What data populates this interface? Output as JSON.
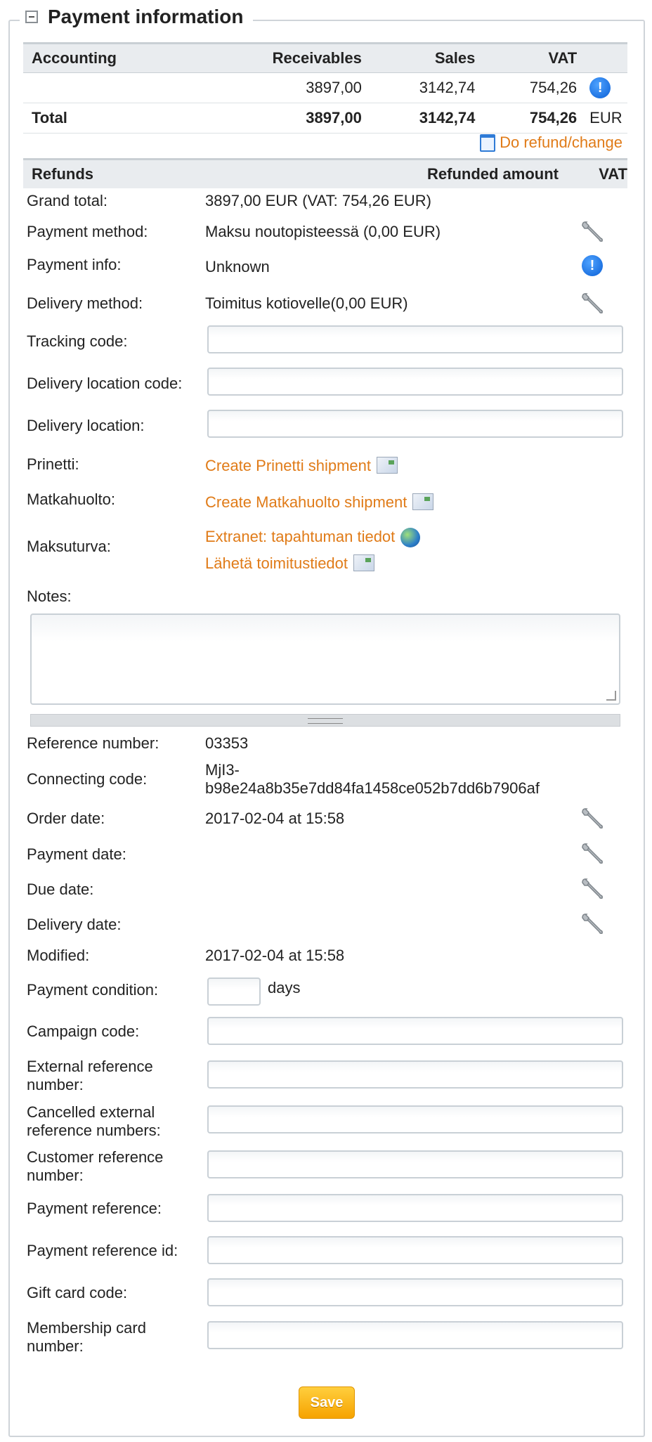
{
  "section": {
    "title": "Payment information"
  },
  "accounting": {
    "headers": [
      "Accounting",
      "Receivables",
      "Sales",
      "VAT"
    ],
    "row": {
      "receivables": "3897,00",
      "sales": "3142,74",
      "vat": "754,26"
    },
    "total": {
      "label": "Total",
      "receivables": "3897,00",
      "sales": "3142,74",
      "vat": "754,26",
      "currency": "EUR"
    }
  },
  "refund_link": "Do refund/change",
  "refunds": {
    "headers": [
      "Refunds",
      "Refunded amount",
      "VAT"
    ]
  },
  "fields": {
    "grand_total": {
      "label": "Grand total:",
      "value": "3897,00 EUR (VAT: 754,26 EUR)"
    },
    "payment_method": {
      "label": "Payment method:",
      "value": "Maksu noutopisteessä (0,00 EUR)"
    },
    "payment_info": {
      "label": "Payment info:",
      "value": "Unknown"
    },
    "delivery_method": {
      "label": "Delivery method:",
      "value": "Toimitus kotiovelle(0,00 EUR)"
    },
    "tracking_code": {
      "label": "Tracking code:",
      "value": ""
    },
    "delivery_location_code": {
      "label": "Delivery location code:",
      "value": ""
    },
    "delivery_location": {
      "label": "Delivery location:",
      "value": ""
    },
    "prinetti": {
      "label": "Prinetti:",
      "link": "Create Prinetti shipment"
    },
    "matkahuolto": {
      "label": "Matkahuolto:",
      "link": "Create Matkahuolto shipment"
    },
    "maksuturva": {
      "label": "Maksuturva:",
      "link1": "Extranet: tapahtuman tiedot",
      "link2": "Lähetä toimitustiedot"
    },
    "notes": {
      "label": "Notes:",
      "value": ""
    },
    "reference_number": {
      "label": "Reference number:",
      "value": "03353"
    },
    "connecting_code": {
      "label": "Connecting code:",
      "value_line1": "MjI3-",
      "value_line2": "b98e24a8b35e7dd84fa1458ce052b7dd6b7906af"
    },
    "order_date": {
      "label": "Order date:",
      "value": "2017-02-04 at 15:58"
    },
    "payment_date": {
      "label": "Payment date:",
      "value": ""
    },
    "due_date": {
      "label": "Due date:",
      "value": ""
    },
    "delivery_date": {
      "label": "Delivery date:",
      "value": ""
    },
    "modified": {
      "label": "Modified:",
      "value": "2017-02-04 at 15:58"
    },
    "payment_condition": {
      "label": "Payment condition:",
      "value": "",
      "unit": "days"
    },
    "campaign_code": {
      "label": "Campaign code:",
      "value": ""
    },
    "external_reference_number": {
      "label_line1": "External reference",
      "label_line2": "number:",
      "value": ""
    },
    "cancelled_external_reference_numbers": {
      "label_line1": "Cancelled external",
      "label_line2": "reference numbers:",
      "value": ""
    },
    "customer_reference_number": {
      "label_line1": "Customer reference",
      "label_line2": "number:",
      "value": ""
    },
    "payment_reference": {
      "label": "Payment reference:",
      "value": ""
    },
    "payment_reference_id": {
      "label": "Payment reference id:",
      "value": ""
    },
    "gift_card_code": {
      "label": "Gift card code:",
      "value": ""
    },
    "membership_card_number": {
      "label_line1": "Membership card",
      "label_line2": "number:",
      "value": ""
    }
  },
  "save_label": "Save",
  "colors": {
    "link": "#e07b18",
    "header_bg": "#e9ecef",
    "save_button": "#f6a300",
    "info_icon": "#0a5fd6"
  }
}
